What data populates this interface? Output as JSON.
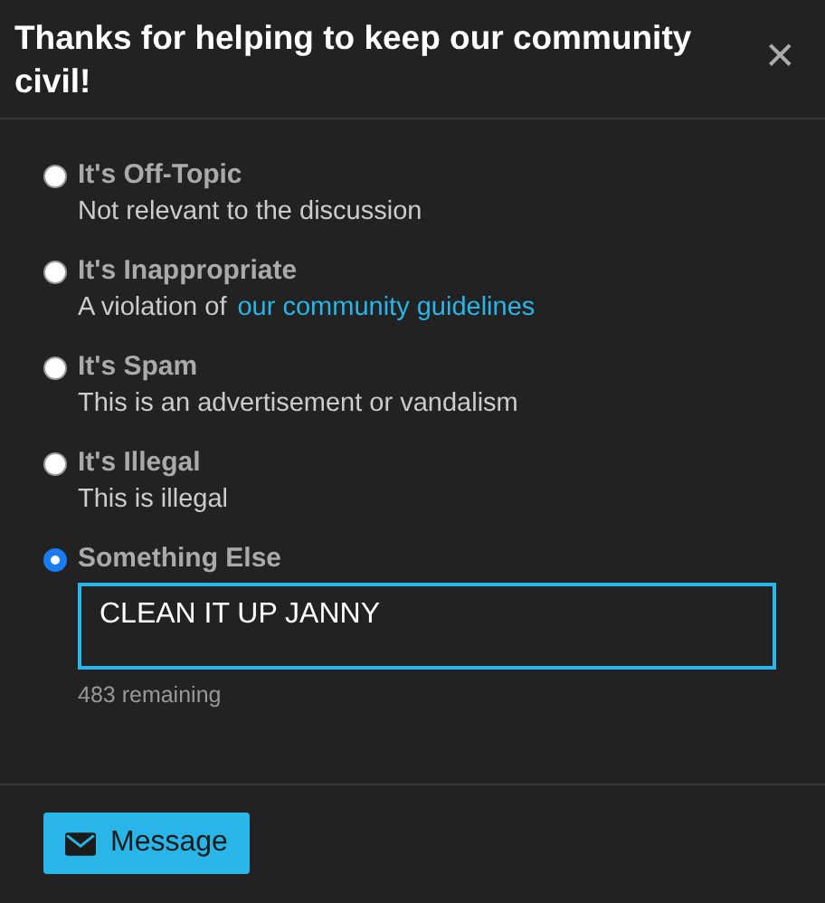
{
  "dialog": {
    "title": "Thanks for helping to keep our community civil!",
    "close": "✕"
  },
  "options": [
    {
      "label": "It's Off-Topic",
      "description": "Not relevant to the discussion",
      "selected": false
    },
    {
      "label": "It's Inappropriate",
      "description": "A violation of",
      "link": "our community guidelines",
      "selected": false
    },
    {
      "label": "It's Spam",
      "description": "This is an advertisement or vandalism",
      "selected": false
    },
    {
      "label": "It's Illegal",
      "description": "This is illegal",
      "selected": false
    },
    {
      "label": "Something Else",
      "selected": true
    }
  ],
  "message": {
    "value": "CLEAN IT UP JANNY",
    "remaining": "483 remaining"
  },
  "button": {
    "label": "Message"
  }
}
